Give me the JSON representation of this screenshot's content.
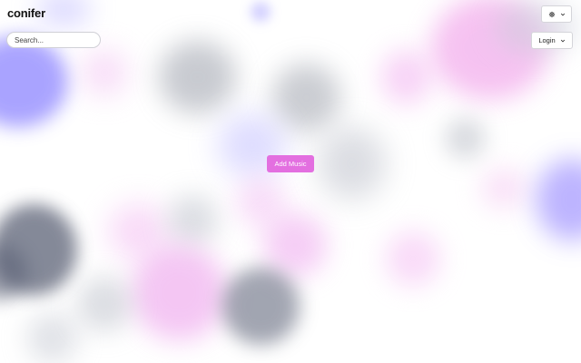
{
  "app": {
    "title": "conifer"
  },
  "search": {
    "placeholder": "Search..."
  },
  "settings": {
    "icon": "gear-icon",
    "menu_icon": "chevron-down-icon"
  },
  "login": {
    "label": "Login",
    "menu_icon": "chevron-down-icon"
  },
  "main": {
    "add_music_label": "Add Music"
  },
  "colors": {
    "accent": "#e36fe0",
    "background": "#ffffff",
    "blob_indigo": "#8c82ff",
    "blob_pink": "#f0a0f0",
    "blob_gray": "#8e92a0",
    "blob_dark": "#50566a"
  }
}
